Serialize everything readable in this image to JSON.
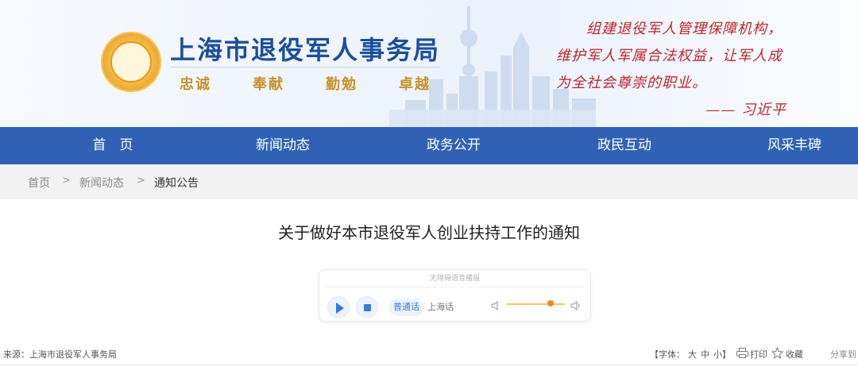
{
  "header": {
    "site_title": "上海市退役军人事务局",
    "motto": [
      "忠诚",
      "奉献",
      "勤勉",
      "卓越"
    ],
    "quote_lines": [
      "组建退役军人管理保障机构，",
      "维护军人军属合法权益，让军人成",
      "为全社会尊崇的职业。"
    ],
    "quote_signature": "—— 习近平",
    "emblem_icon": "bureau-emblem",
    "accent_color": "#2f62b4",
    "quote_color": "#c0262c"
  },
  "nav": {
    "items": [
      "首　页",
      "新闻动态",
      "政务公开",
      "政民互动",
      "风采丰碑"
    ]
  },
  "breadcrumb": {
    "items": [
      "首页",
      "新闻动态",
      "通知公告"
    ],
    "separator": ">"
  },
  "article": {
    "title": "关于做好本市退役军人创业扶持工作的通知"
  },
  "player": {
    "header_text": "无障碍语音播报",
    "languages": [
      "普通话",
      "上海话"
    ],
    "active_language": "普通话",
    "volume_level": 0.75,
    "icons": [
      "play-icon",
      "stop-icon",
      "volume-low-icon",
      "volume-high-icon"
    ]
  },
  "meta": {
    "source": "来源：上海市退役军人事务局",
    "font_size_label": "【字体：",
    "font_sizes": [
      "大",
      "中",
      "小】"
    ],
    "print_label": "打印",
    "favorite_label": "收藏",
    "share_label": "分享到"
  }
}
